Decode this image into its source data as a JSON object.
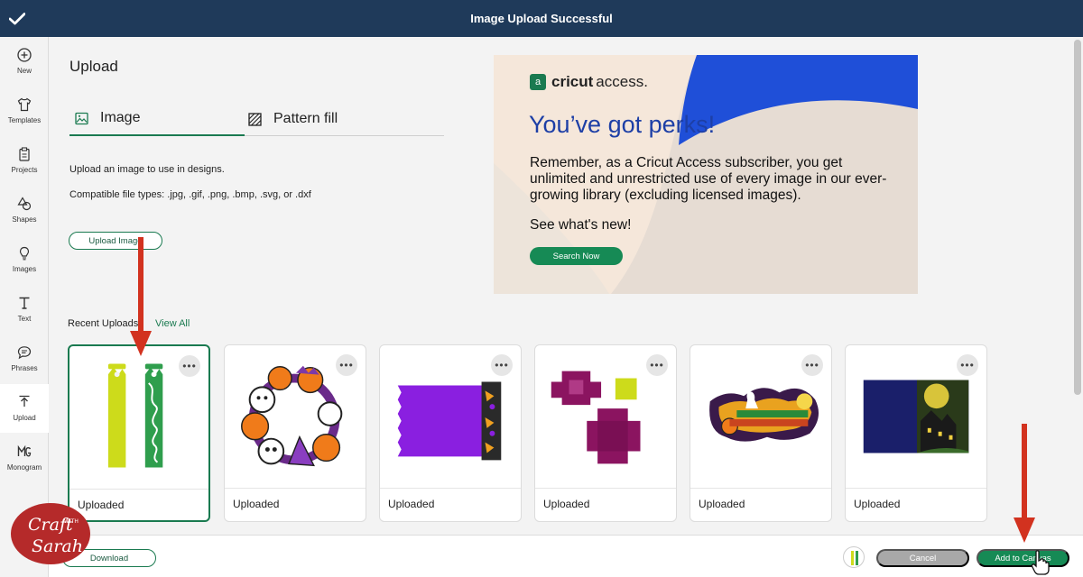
{
  "topbar": {
    "title": "Image Upload Successful",
    "icon": "check-icon"
  },
  "sidebar": {
    "items": [
      {
        "label": "New",
        "icon": "plus-circle-icon",
        "active": false
      },
      {
        "label": "Templates",
        "icon": "shirt-icon",
        "active": false
      },
      {
        "label": "Projects",
        "icon": "clipboard-icon",
        "active": false
      },
      {
        "label": "Shapes",
        "icon": "shapes-icon",
        "active": false
      },
      {
        "label": "Images",
        "icon": "bulb-icon",
        "active": false
      },
      {
        "label": "Text",
        "icon": "text-icon",
        "active": false
      },
      {
        "label": "Phrases",
        "icon": "speech-bubble-icon",
        "active": false
      },
      {
        "label": "Upload",
        "icon": "upload-icon",
        "active": true
      },
      {
        "label": "Monogram",
        "icon": "monogram-icon",
        "active": false
      }
    ]
  },
  "upload": {
    "heading": "Upload",
    "tabs": [
      {
        "label": "Image",
        "icon": "image-icon",
        "active": true
      },
      {
        "label": "Pattern fill",
        "icon": "pattern-icon",
        "active": false
      }
    ],
    "description": "Upload an image to use in designs.",
    "file_types": "Compatible file types: .jpg, .gif, .png, .bmp, .svg, or .dxf",
    "upload_button": "Upload Image"
  },
  "promo": {
    "brand": "cricut",
    "brand_suffix": "access.",
    "logo_mark": "a",
    "headline": "You’ve got perks!",
    "body": "Remember, as a Cricut Access subscriber, you get unlimited and unrestricted use of every image in our ever-growing library (excluding licensed images).",
    "cta_text": "See what's new!",
    "button": "Search Now",
    "colors": {
      "accent_blue": "#1d3fa6",
      "background": "#f5e7da",
      "brand_green": "#168a55"
    }
  },
  "recent": {
    "label": "Recent Uploads",
    "view_all": "View All",
    "cards": [
      {
        "caption": "Uploaded",
        "selected": true,
        "more": "•••"
      },
      {
        "caption": "Uploaded",
        "selected": false,
        "more": "•••"
      },
      {
        "caption": "Uploaded",
        "selected": false,
        "more": "•••"
      },
      {
        "caption": "Uploaded",
        "selected": false,
        "more": "•••"
      },
      {
        "caption": "Uploaded",
        "selected": false,
        "more": "•••"
      },
      {
        "caption": "Uploaded",
        "selected": false,
        "more": "•••"
      }
    ]
  },
  "bottombar": {
    "download_button": "Download",
    "cancel_button": "Cancel",
    "add_button": "Add to Canvas"
  },
  "watermark": {
    "line1": "Craft",
    "line2": "WITH",
    "line3": "Sarah"
  }
}
